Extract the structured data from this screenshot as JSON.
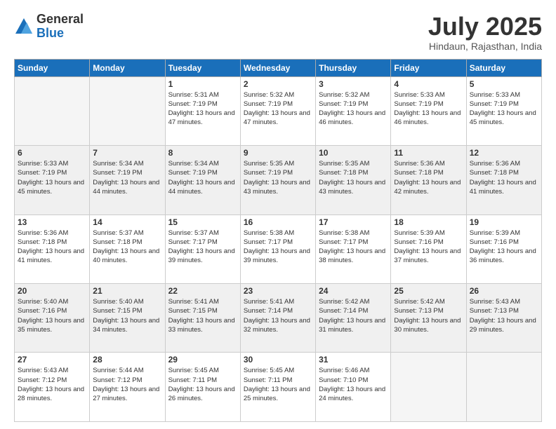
{
  "logo": {
    "general": "General",
    "blue": "Blue"
  },
  "title": "July 2025",
  "location": "Hindaun, Rajasthan, India",
  "days_of_week": [
    "Sunday",
    "Monday",
    "Tuesday",
    "Wednesday",
    "Thursday",
    "Friday",
    "Saturday"
  ],
  "weeks": [
    [
      {
        "day": "",
        "empty": true
      },
      {
        "day": "",
        "empty": true
      },
      {
        "day": "1",
        "sunrise": "5:31 AM",
        "sunset": "7:19 PM",
        "daylight": "13 hours and 47 minutes."
      },
      {
        "day": "2",
        "sunrise": "5:32 AM",
        "sunset": "7:19 PM",
        "daylight": "13 hours and 47 minutes."
      },
      {
        "day": "3",
        "sunrise": "5:32 AM",
        "sunset": "7:19 PM",
        "daylight": "13 hours and 46 minutes."
      },
      {
        "day": "4",
        "sunrise": "5:33 AM",
        "sunset": "7:19 PM",
        "daylight": "13 hours and 46 minutes."
      },
      {
        "day": "5",
        "sunrise": "5:33 AM",
        "sunset": "7:19 PM",
        "daylight": "13 hours and 45 minutes."
      }
    ],
    [
      {
        "day": "6",
        "sunrise": "5:33 AM",
        "sunset": "7:19 PM",
        "daylight": "13 hours and 45 minutes."
      },
      {
        "day": "7",
        "sunrise": "5:34 AM",
        "sunset": "7:19 PM",
        "daylight": "13 hours and 44 minutes."
      },
      {
        "day": "8",
        "sunrise": "5:34 AM",
        "sunset": "7:19 PM",
        "daylight": "13 hours and 44 minutes."
      },
      {
        "day": "9",
        "sunrise": "5:35 AM",
        "sunset": "7:19 PM",
        "daylight": "13 hours and 43 minutes."
      },
      {
        "day": "10",
        "sunrise": "5:35 AM",
        "sunset": "7:18 PM",
        "daylight": "13 hours and 43 minutes."
      },
      {
        "day": "11",
        "sunrise": "5:36 AM",
        "sunset": "7:18 PM",
        "daylight": "13 hours and 42 minutes."
      },
      {
        "day": "12",
        "sunrise": "5:36 AM",
        "sunset": "7:18 PM",
        "daylight": "13 hours and 41 minutes."
      }
    ],
    [
      {
        "day": "13",
        "sunrise": "5:36 AM",
        "sunset": "7:18 PM",
        "daylight": "13 hours and 41 minutes."
      },
      {
        "day": "14",
        "sunrise": "5:37 AM",
        "sunset": "7:18 PM",
        "daylight": "13 hours and 40 minutes."
      },
      {
        "day": "15",
        "sunrise": "5:37 AM",
        "sunset": "7:17 PM",
        "daylight": "13 hours and 39 minutes."
      },
      {
        "day": "16",
        "sunrise": "5:38 AM",
        "sunset": "7:17 PM",
        "daylight": "13 hours and 39 minutes."
      },
      {
        "day": "17",
        "sunrise": "5:38 AM",
        "sunset": "7:17 PM",
        "daylight": "13 hours and 38 minutes."
      },
      {
        "day": "18",
        "sunrise": "5:39 AM",
        "sunset": "7:16 PM",
        "daylight": "13 hours and 37 minutes."
      },
      {
        "day": "19",
        "sunrise": "5:39 AM",
        "sunset": "7:16 PM",
        "daylight": "13 hours and 36 minutes."
      }
    ],
    [
      {
        "day": "20",
        "sunrise": "5:40 AM",
        "sunset": "7:16 PM",
        "daylight": "13 hours and 35 minutes."
      },
      {
        "day": "21",
        "sunrise": "5:40 AM",
        "sunset": "7:15 PM",
        "daylight": "13 hours and 34 minutes."
      },
      {
        "day": "22",
        "sunrise": "5:41 AM",
        "sunset": "7:15 PM",
        "daylight": "13 hours and 33 minutes."
      },
      {
        "day": "23",
        "sunrise": "5:41 AM",
        "sunset": "7:14 PM",
        "daylight": "13 hours and 32 minutes."
      },
      {
        "day": "24",
        "sunrise": "5:42 AM",
        "sunset": "7:14 PM",
        "daylight": "13 hours and 31 minutes."
      },
      {
        "day": "25",
        "sunrise": "5:42 AM",
        "sunset": "7:13 PM",
        "daylight": "13 hours and 30 minutes."
      },
      {
        "day": "26",
        "sunrise": "5:43 AM",
        "sunset": "7:13 PM",
        "daylight": "13 hours and 29 minutes."
      }
    ],
    [
      {
        "day": "27",
        "sunrise": "5:43 AM",
        "sunset": "7:12 PM",
        "daylight": "13 hours and 28 minutes."
      },
      {
        "day": "28",
        "sunrise": "5:44 AM",
        "sunset": "7:12 PM",
        "daylight": "13 hours and 27 minutes."
      },
      {
        "day": "29",
        "sunrise": "5:45 AM",
        "sunset": "7:11 PM",
        "daylight": "13 hours and 26 minutes."
      },
      {
        "day": "30",
        "sunrise": "5:45 AM",
        "sunset": "7:11 PM",
        "daylight": "13 hours and 25 minutes."
      },
      {
        "day": "31",
        "sunrise": "5:46 AM",
        "sunset": "7:10 PM",
        "daylight": "13 hours and 24 minutes."
      },
      {
        "day": "",
        "empty": true
      },
      {
        "day": "",
        "empty": true
      }
    ]
  ]
}
